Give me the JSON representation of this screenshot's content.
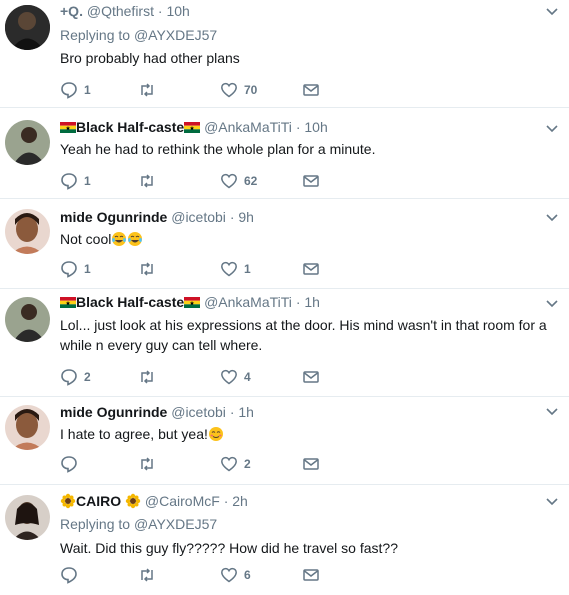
{
  "tweets": [
    {
      "name": "+Q.",
      "handle": "@Qthefirst",
      "time": "10h",
      "replying_label": "Replying to",
      "replying_handle": "@AYXDEJ57",
      "text": "Bro probably had other plans",
      "replies": "1",
      "retweets": "",
      "likes": "70"
    },
    {
      "name": "Black Half-caste",
      "handle": "@AnkaMaTiTi",
      "time": "10h",
      "text": "Yeah he had to rethink the whole plan for a minute.",
      "replies": "1",
      "retweets": "",
      "likes": "62"
    },
    {
      "name": "mide Ogunrinde",
      "handle": "@icetobi",
      "time": "9h",
      "text": "Not cool",
      "replies": "1",
      "retweets": "",
      "likes": "1"
    },
    {
      "name": "Black Half-caste",
      "handle": "@AnkaMaTiTi",
      "time": "1h",
      "text": "Lol... just look at his expressions at the door. His mind wasn't in that room for a while n every guy can tell where.",
      "replies": "2",
      "retweets": "",
      "likes": "4"
    },
    {
      "name": "mide Ogunrinde",
      "handle": "@icetobi",
      "time": "1h",
      "text": "I hate to agree, but yea!",
      "replies": "",
      "retweets": "",
      "likes": "2"
    },
    {
      "name": "CAIRO",
      "handle": "@CairoMcF",
      "time": "2h",
      "replying_label": "Replying to",
      "replying_handle": "@AYXDEJ57",
      "text": "Wait. Did this guy fly????? How did he travel so fast??",
      "replies": "",
      "retweets": "",
      "likes": "6"
    }
  ],
  "separator": "·",
  "icons": {
    "reply": "reply-icon",
    "retweet": "retweet-icon",
    "like": "heart-icon",
    "message": "envelope-icon",
    "more": "chevron-down-icon",
    "flag": "ghana-flag-icon",
    "tears": "tears-of-joy-icon",
    "blush": "blush-icon",
    "sunflower": "sunflower-icon"
  },
  "colors": {
    "text": "#14171a",
    "secondary": "#657786",
    "border": "#e6ecf0",
    "first_bg": "#ffffff"
  }
}
